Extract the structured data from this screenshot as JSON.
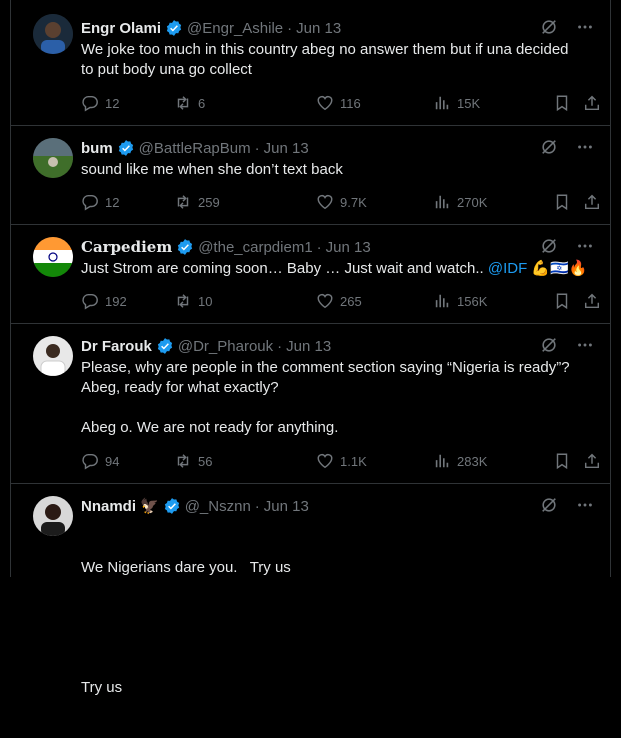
{
  "tweets": [
    {
      "name": "Engr Olami",
      "handle": "@Engr_Ashile",
      "date": "Jun 13",
      "lines": [
        "We joke too much in this country abeg no answer them but if una decided",
        "to put body una go collect"
      ],
      "replies": "12",
      "reposts": "6",
      "likes": "116",
      "views": "15K"
    },
    {
      "name": "bum",
      "handle": "@BattleRapBum",
      "date": "Jun 13",
      "lines": [
        "sound like me when she don’t text back"
      ],
      "replies": "12",
      "reposts": "259",
      "likes": "9.7K",
      "views": "270K"
    },
    {
      "name": "Carpediem",
      "handle": "@the_carpdiem1",
      "date": "Jun 13",
      "text": "Just Strom are coming soon… Baby … Just wait and watch.. ",
      "mention": "@IDF",
      "emojis": "💪🇮🇱🔥",
      "replies": "192",
      "reposts": "10",
      "likes": "265",
      "views": "156K"
    },
    {
      "name": "Dr Farouk",
      "handle": "@Dr_Pharouk",
      "date": "Jun 13",
      "lines": [
        "Please, why are people in the comment section saying “Nigeria is ready”?",
        "Abeg, ready for what exactly?",
        "",
        "Abeg o. We are not ready for anything."
      ],
      "replies": "94",
      "reposts": "56",
      "likes": "1.1K",
      "views": "283K"
    },
    {
      "name": "Nnamdi",
      "name_emoji": "🦅",
      "handle": "@_Nsznn",
      "date": "Jun 13",
      "lines": [
        "We Nigerians dare you.   Try us",
        "",
        "Try us"
      ]
    }
  ],
  "dot": "·",
  "colors": {
    "background": "#000000",
    "verified": "#1d9bf0",
    "text": "#e7e9ea",
    "muted": "#71767b",
    "divider": "#2f3336"
  }
}
